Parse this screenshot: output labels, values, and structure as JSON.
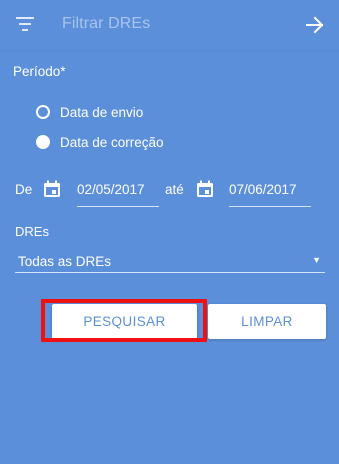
{
  "header": {
    "title": "Filtrar DREs",
    "filter_icon": "filter-list-icon",
    "forward_icon": "arrow-right-icon"
  },
  "periodo": {
    "label": "Período*",
    "options": [
      {
        "label": "Data de envio",
        "selected": false
      },
      {
        "label": "Data de correção",
        "selected": true
      }
    ]
  },
  "date_range": {
    "from_label": "De",
    "to_label": "até",
    "from_value": "02/05/2017",
    "to_value": "07/06/2017",
    "calendar_icon": "calendar-icon"
  },
  "dres": {
    "label": "DREs",
    "selected": "Todas as DREs"
  },
  "actions": {
    "search_label": "PESQUISAR",
    "clear_label": "LIMPAR"
  },
  "colors": {
    "background": "#5b8fd9",
    "title_muted": "#a9c4ee",
    "highlight": "#ee1111",
    "button_bg": "#ffffff",
    "button_text": "#5b8fd9"
  }
}
